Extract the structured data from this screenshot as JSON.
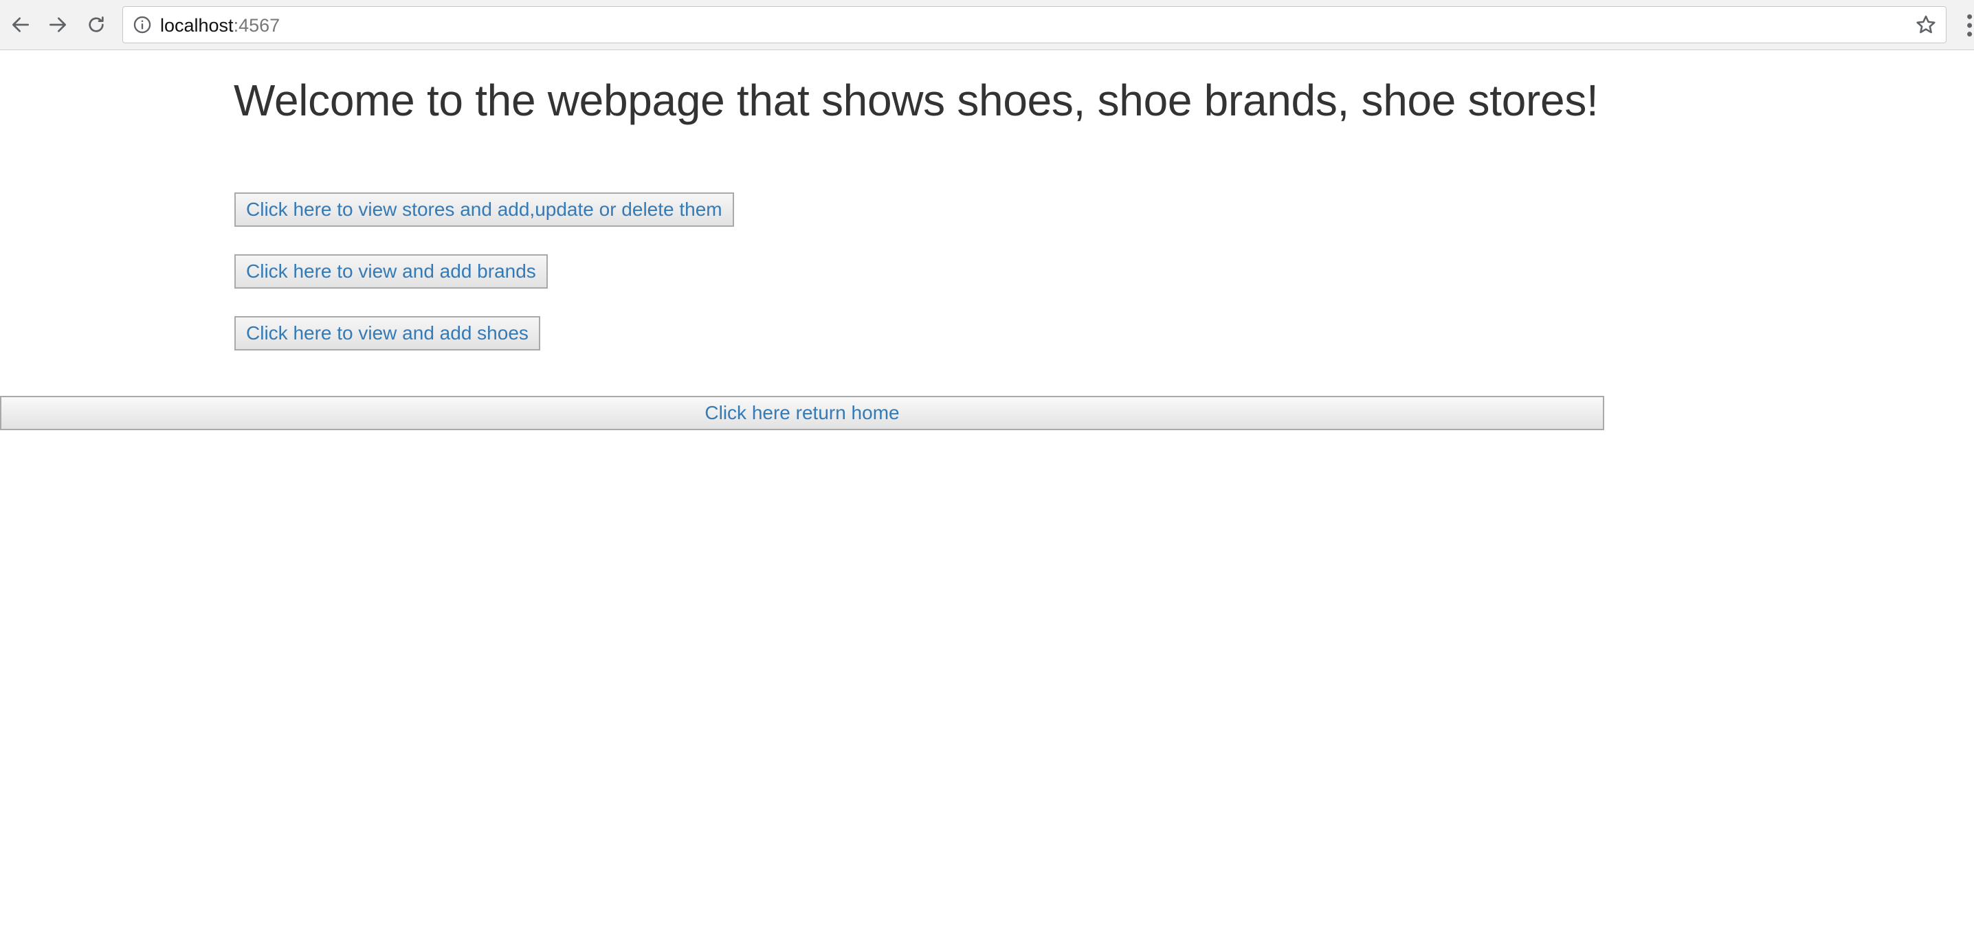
{
  "browser": {
    "url_host": "localhost",
    "url_port": ":4567",
    "back_icon": "arrow-left-icon",
    "forward_icon": "arrow-right-icon",
    "reload_icon": "reload-icon",
    "info_icon": "info-circle-icon",
    "bookmark_icon": "star-outline-icon",
    "menu_icon": "vertical-dots-icon"
  },
  "main": {
    "title": "Welcome to the webpage that shows shoes, shoe brands, shoe stores!",
    "links": [
      {
        "label": "Click here to view stores and add,update or delete them"
      },
      {
        "label": "Click here to view and add brands"
      },
      {
        "label": "Click here to view and add shoes"
      }
    ],
    "home_label": "Click here return home"
  },
  "colors": {
    "link": "#337ab7",
    "title": "#333333",
    "button_border": "#a9a9a9",
    "chrome_bg": "#f2f2f2"
  }
}
